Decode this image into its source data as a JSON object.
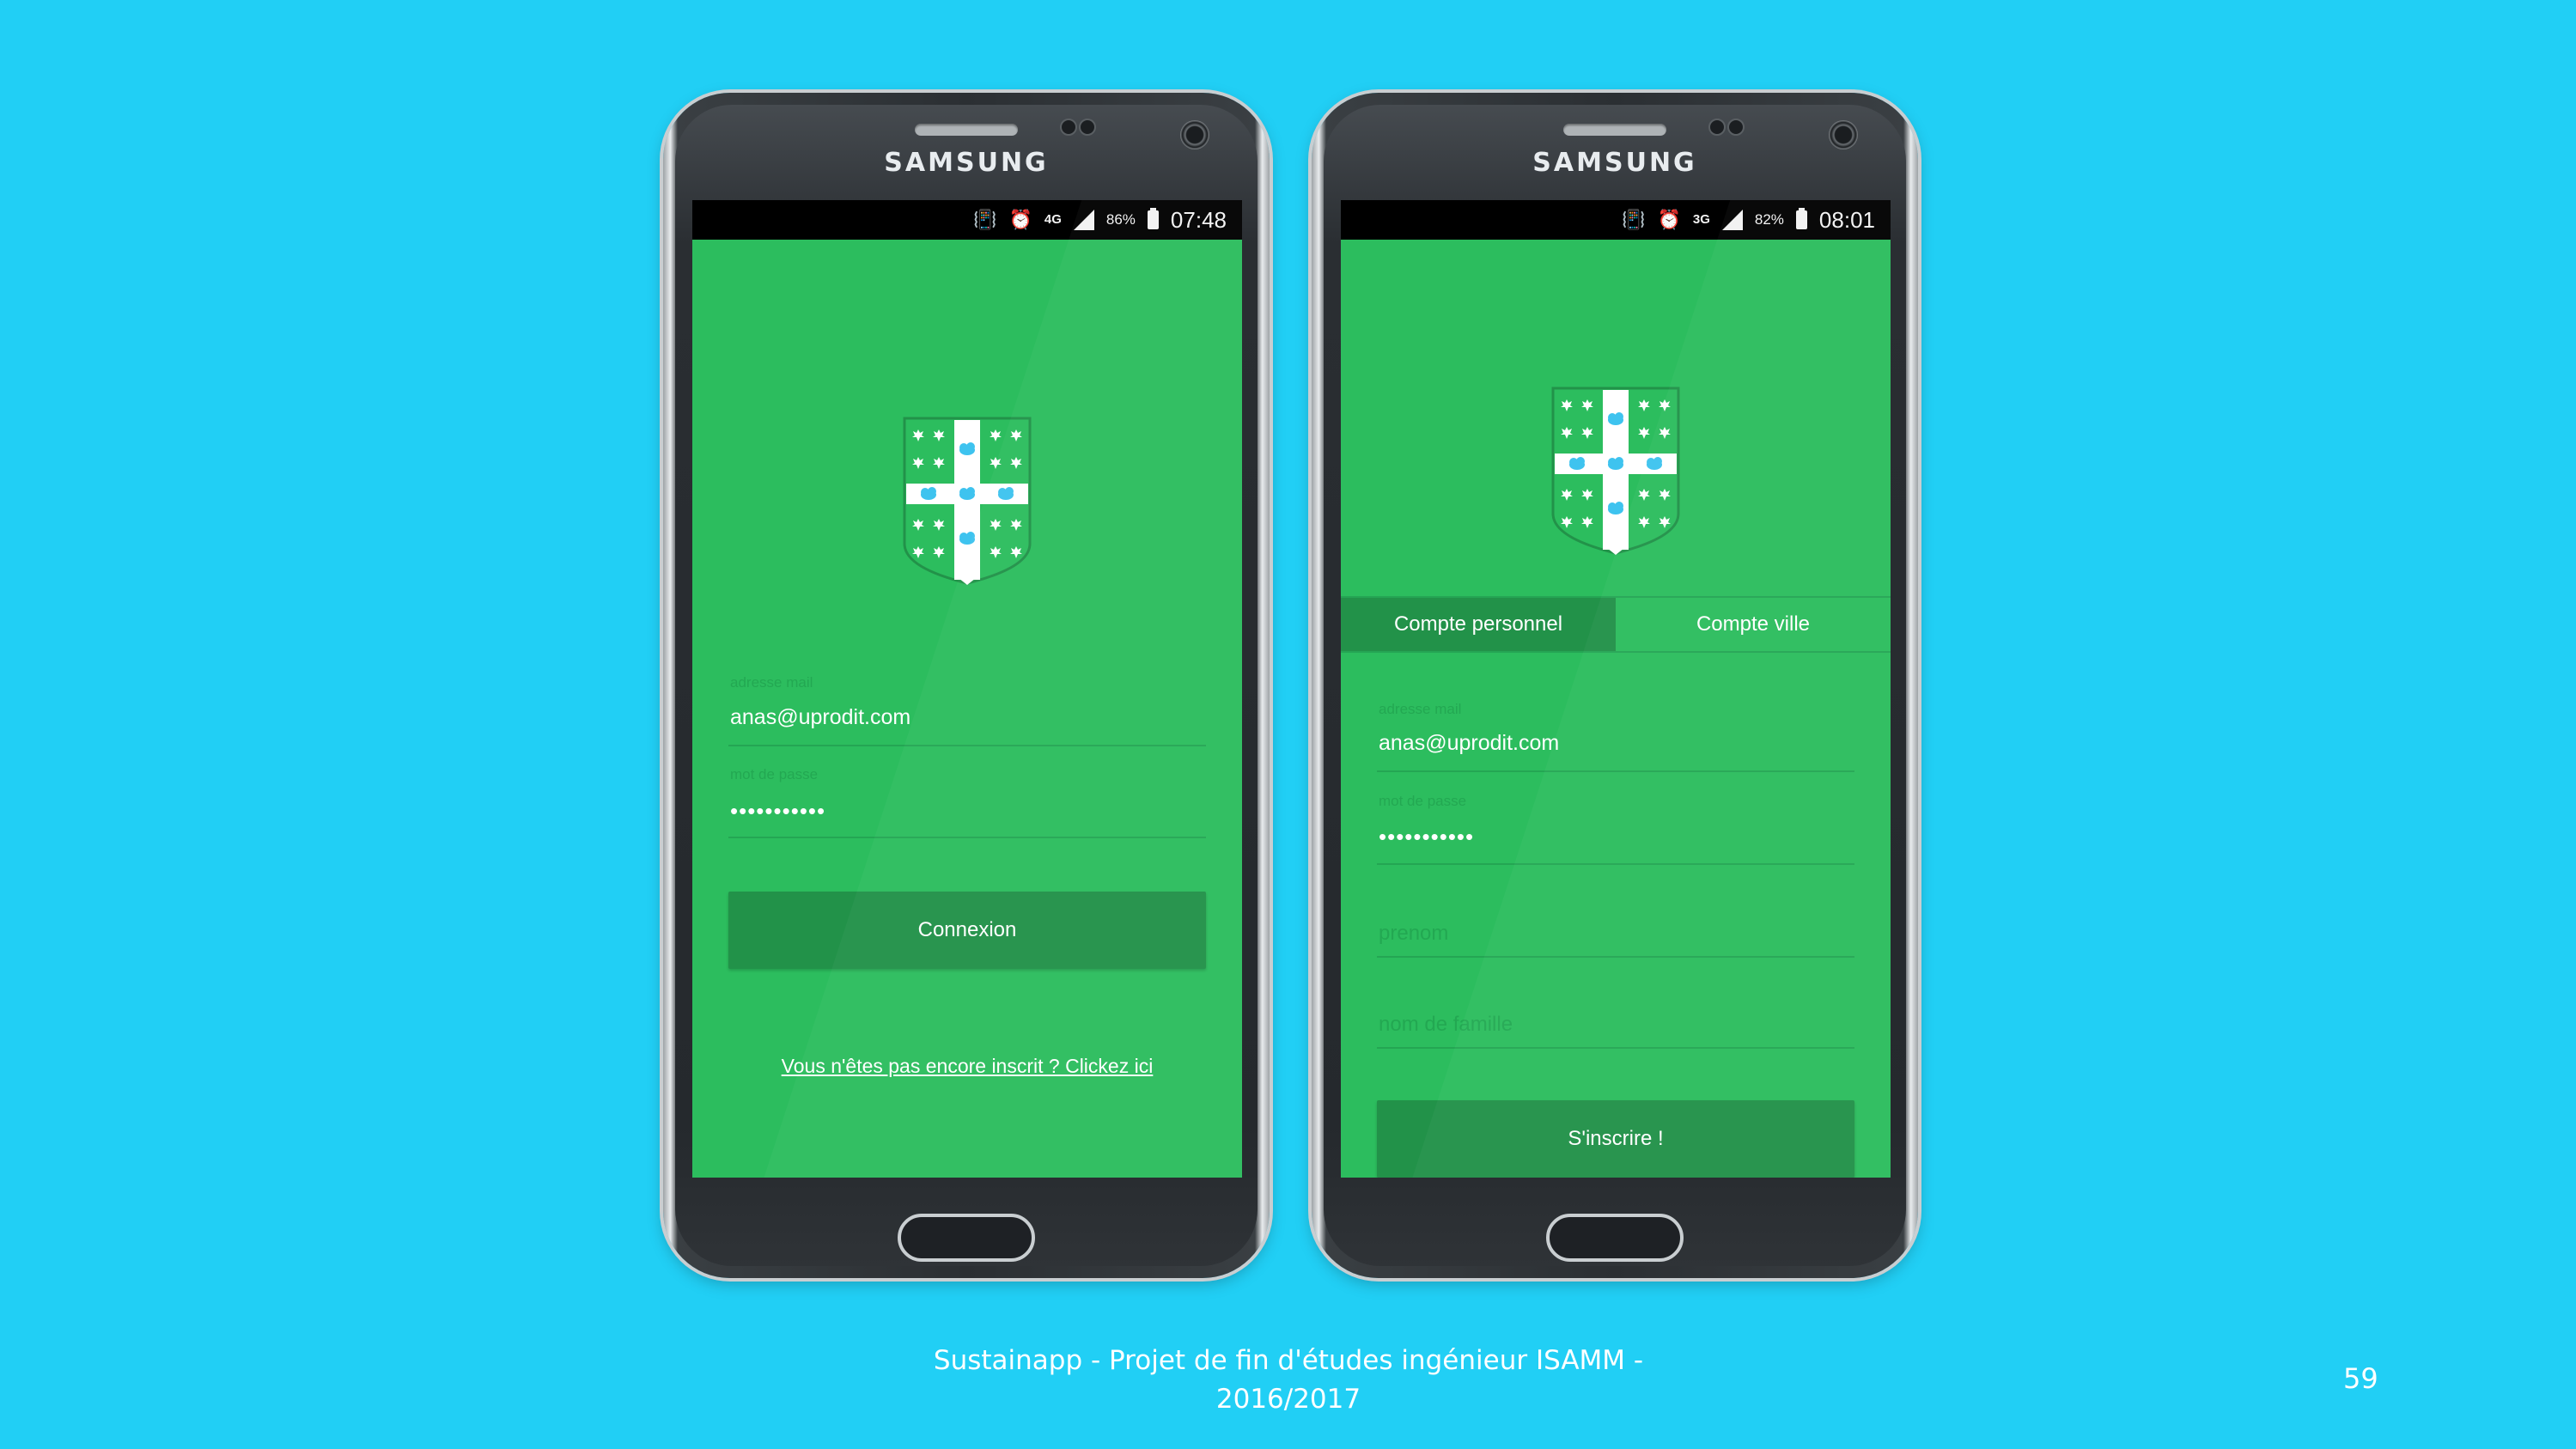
{
  "phones": [
    {
      "brand": "SAMSUNG",
      "status": {
        "network": "4G",
        "battery": "86%",
        "time": "07:48"
      },
      "login": {
        "email_label": "adresse mail",
        "email_value": "anas@uprodit.com",
        "password_label": "mot de passe",
        "password_value": "•••••••••••",
        "submit_label": "Connexion",
        "signup_link": "Vous n'êtes pas encore inscrit ? Clickez ici"
      }
    },
    {
      "brand": "SAMSUNG",
      "status": {
        "network": "3G",
        "battery": "82%",
        "time": "08:01"
      },
      "signup": {
        "tabs": [
          "Compte personnel",
          "Compte ville"
        ],
        "active_tab": "Compte personnel",
        "email_label": "adresse mail",
        "email_value": "anas@uprodit.com",
        "password_label": "mot de passe",
        "password_value": "•••••••••••",
        "firstname_placeholder": "prenom",
        "lastname_placeholder": "nom de famille",
        "submit_label": "S'inscrire !"
      }
    }
  ],
  "footer": {
    "line1": "Sustainapp - Projet de fin d'études ingénieur ISAMM -",
    "line2": "2016/2017",
    "page_number": "59"
  },
  "colors": {
    "background": "#21cff5",
    "app_green": "#2cbd5e",
    "button_green": "#229249",
    "crest_blue": "#3ec3ef"
  },
  "icons": [
    "vibrate-icon",
    "alarm-icon",
    "signal-icon",
    "battery-icon",
    "crest-logo"
  ]
}
